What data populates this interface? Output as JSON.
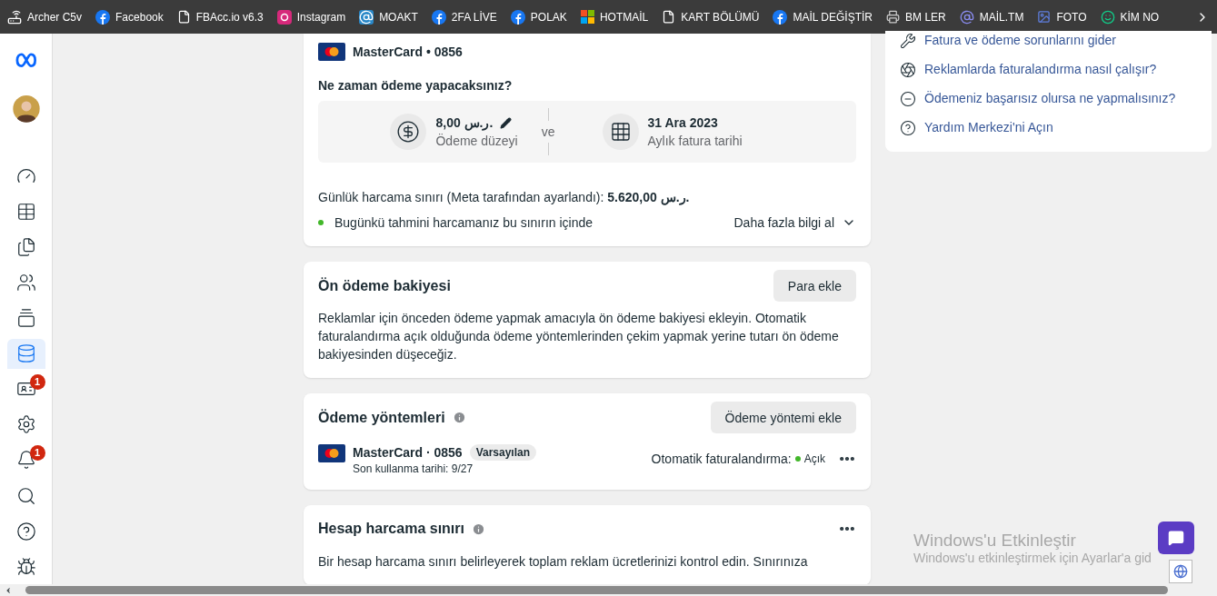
{
  "bookmarks": [
    {
      "label": "Archer C5v"
    },
    {
      "label": "Facebook"
    },
    {
      "label": "FBAcc.io v6.3"
    },
    {
      "label": "Instagram"
    },
    {
      "label": "MOAKT"
    },
    {
      "label": "2FA LİVE"
    },
    {
      "label": "POLAK"
    },
    {
      "label": "HOTMAİL"
    },
    {
      "label": "KART BÖLÜMÜ"
    },
    {
      "label": "MAİL DEĞİŞTİR"
    },
    {
      "label": "BM LER"
    },
    {
      "label": "MAİL.TM"
    },
    {
      "label": "FOTO"
    },
    {
      "label": "KİM NO"
    }
  ],
  "sidebar": {
    "items": [
      {
        "selected": false
      },
      {
        "selected": false
      },
      {
        "selected": false
      },
      {
        "selected": false
      },
      {
        "selected": false
      },
      {
        "selected": true
      },
      {
        "selected": false,
        "badge": "1"
      },
      {
        "selected": false
      },
      {
        "selected": false,
        "badge": "1"
      },
      {
        "selected": false
      },
      {
        "selected": false
      },
      {
        "selected": false
      }
    ]
  },
  "billing_card": {
    "card": "MasterCard • 0856",
    "question": "Ne zaman ödeme yapacaksınız?",
    "threshold": {
      "amount": "8,00 ر.س.",
      "label": "Ödeme düzeyi"
    },
    "joiner": "ve",
    "bill_date": {
      "date": "31 Ara 2023",
      "label": "Aylık fatura tarihi"
    },
    "daily_limit": "Günlük harcama sınırı (Meta tarafından ayarlandı): **5.620,00 ر.س.**",
    "status": "Bugünkü tahmini harcamanız bu sınırın içinde",
    "more": "Daha fazla bilgi al"
  },
  "prepaid": {
    "title": "Ön ödeme bakiyesi",
    "button": "Para ekle",
    "text": "Reklamlar için önceden ödeme yapmak amacıyla ön ödeme bakiyesi ekleyin. Otomatik faturalandırma açık olduğunda ödeme yöntemlerinden çekim yapmak yerine tutarı ön ödeme bakiyesinden düşeceğiz."
  },
  "payment_methods": {
    "title": "Ödeme yöntemleri",
    "button": "Ödeme yöntemi ekle",
    "methods": [
      {
        "name": "MasterCard · 0856",
        "badge": "Varsayılan",
        "expiry": "Son kullanma tarihi: 9/27",
        "autopay_label": "Otomatik faturalandırma:",
        "autopay": "Açık",
        "on": true
      }
    ]
  },
  "spending_limit": {
    "title": "Hesap harcama sınırı",
    "text": "Bir hesap harcama sınırı belirleyerek toplam reklam ücretlerinizi kontrol edin. Sınırınıza"
  },
  "help_links": [
    "Fatura ve ödeme sorunlarını gider",
    "Reklamlarda faturalandırma nasıl çalışır?",
    "Ödemeniz başarısız olursa ne yapmalısınız?",
    "Yardım Merkezi'ni Açın"
  ],
  "activation": {
    "title": "Windows'u Etkinleştir",
    "text": "Windows'u etkinleştirmek için Ayarlar'a gid"
  }
}
